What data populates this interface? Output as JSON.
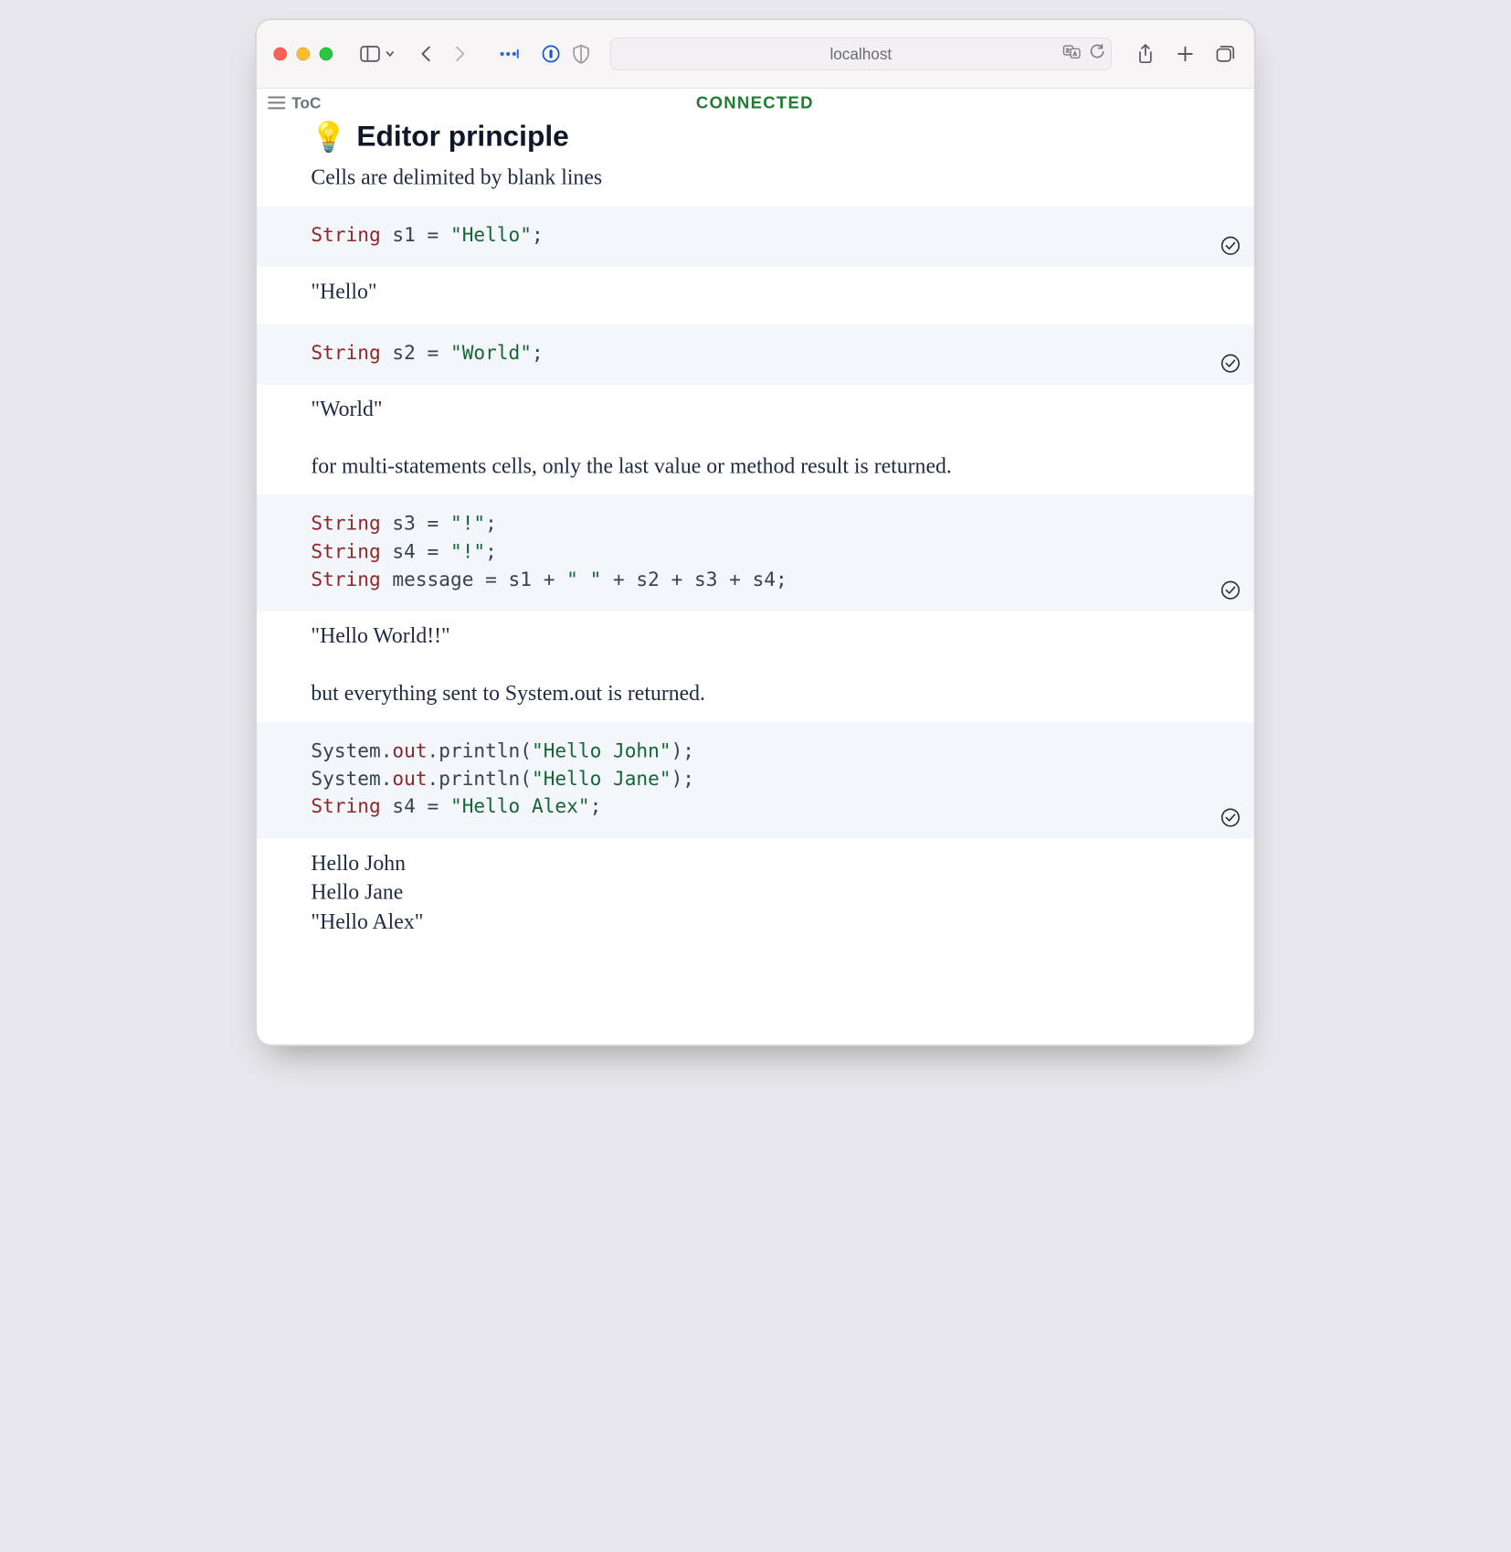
{
  "toolbar": {
    "address": "localhost"
  },
  "header": {
    "toc_label": "ToC",
    "status": "CONNECTED",
    "emoji": "💡",
    "title": "Editor principle"
  },
  "blocks": [
    {
      "kind": "prose",
      "text": "Cells are delimited by blank lines"
    },
    {
      "kind": "code",
      "tokens": [
        {
          "t": "kw",
          "v": "String"
        },
        {
          "t": "p",
          "v": " s1 "
        },
        {
          "t": "p",
          "v": "="
        },
        {
          "t": "p",
          "v": " "
        },
        {
          "t": "str",
          "v": "\"Hello\""
        },
        {
          "t": "p",
          "v": ";"
        }
      ]
    },
    {
      "kind": "output",
      "text": "\"Hello\""
    },
    {
      "kind": "code",
      "tokens": [
        {
          "t": "kw",
          "v": "String"
        },
        {
          "t": "p",
          "v": " s2 "
        },
        {
          "t": "p",
          "v": "="
        },
        {
          "t": "p",
          "v": " "
        },
        {
          "t": "str",
          "v": "\"World\""
        },
        {
          "t": "p",
          "v": ";"
        }
      ]
    },
    {
      "kind": "output",
      "text": "\"World\""
    },
    {
      "kind": "prose",
      "text": "for multi-statements cells, only the last value or method result is returned."
    },
    {
      "kind": "code",
      "tokens": [
        {
          "t": "kw",
          "v": "String"
        },
        {
          "t": "p",
          "v": " s3 "
        },
        {
          "t": "p",
          "v": "="
        },
        {
          "t": "p",
          "v": " "
        },
        {
          "t": "str",
          "v": "\"!\""
        },
        {
          "t": "p",
          "v": ";"
        },
        {
          "t": "nl"
        },
        {
          "t": "kw",
          "v": "String"
        },
        {
          "t": "p",
          "v": " s4 "
        },
        {
          "t": "p",
          "v": "="
        },
        {
          "t": "p",
          "v": " "
        },
        {
          "t": "str",
          "v": "\"!\""
        },
        {
          "t": "p",
          "v": ";"
        },
        {
          "t": "nl"
        },
        {
          "t": "kw",
          "v": "String"
        },
        {
          "t": "p",
          "v": " message "
        },
        {
          "t": "p",
          "v": "="
        },
        {
          "t": "p",
          "v": " s1 "
        },
        {
          "t": "p",
          "v": "+"
        },
        {
          "t": "p",
          "v": " "
        },
        {
          "t": "str",
          "v": "\" \""
        },
        {
          "t": "p",
          "v": " "
        },
        {
          "t": "p",
          "v": "+"
        },
        {
          "t": "p",
          "v": " s2 "
        },
        {
          "t": "p",
          "v": "+"
        },
        {
          "t": "p",
          "v": " s3 "
        },
        {
          "t": "p",
          "v": "+"
        },
        {
          "t": "p",
          "v": " s4"
        },
        {
          "t": "p",
          "v": ";"
        }
      ]
    },
    {
      "kind": "output",
      "text": "\"Hello World!!\""
    },
    {
      "kind": "prose",
      "text": "but everything sent to System.out is returned."
    },
    {
      "kind": "code",
      "tokens": [
        {
          "t": "p",
          "v": "System"
        },
        {
          "t": "p",
          "v": "."
        },
        {
          "t": "kw",
          "v": "out"
        },
        {
          "t": "p",
          "v": "."
        },
        {
          "t": "p",
          "v": "println("
        },
        {
          "t": "str",
          "v": "\"Hello John\""
        },
        {
          "t": "p",
          "v": ");"
        },
        {
          "t": "nl"
        },
        {
          "t": "p",
          "v": "System"
        },
        {
          "t": "p",
          "v": "."
        },
        {
          "t": "kw",
          "v": "out"
        },
        {
          "t": "p",
          "v": "."
        },
        {
          "t": "p",
          "v": "println("
        },
        {
          "t": "str",
          "v": "\"Hello Jane\""
        },
        {
          "t": "p",
          "v": ");"
        },
        {
          "t": "nl"
        },
        {
          "t": "kw",
          "v": "String"
        },
        {
          "t": "p",
          "v": " s4 "
        },
        {
          "t": "p",
          "v": "="
        },
        {
          "t": "p",
          "v": " "
        },
        {
          "t": "str",
          "v": "\"Hello Alex\""
        },
        {
          "t": "p",
          "v": ";"
        }
      ]
    },
    {
      "kind": "output",
      "text": "Hello John\nHello Jane\n\"Hello Alex\""
    }
  ]
}
